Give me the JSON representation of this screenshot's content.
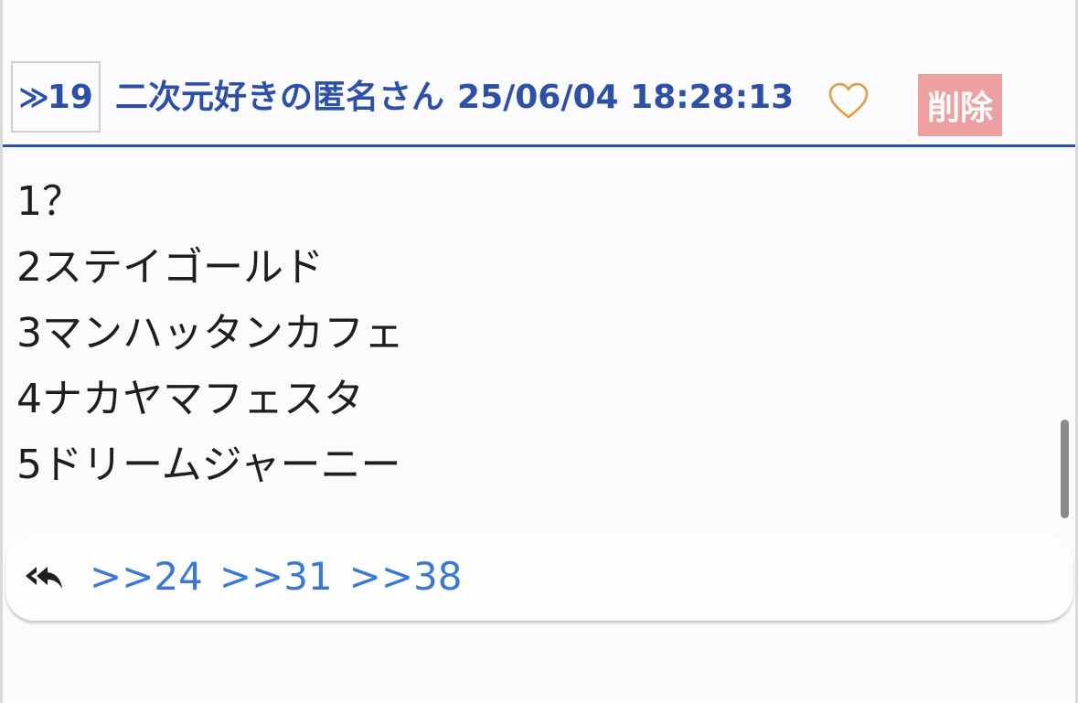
{
  "post": {
    "number_prefix": "≫",
    "number": "19",
    "poster_name": "二次元好きの匿名さん",
    "timestamp": "25/06/04 18:28:13",
    "delete_label": "削除",
    "body_lines": [
      "1？",
      "2ステイゴールド",
      "3マンハッタンカフェ",
      "4ナカヤマフェスタ",
      "5ドリームジャーニー"
    ],
    "replies": [
      ">>24",
      ">>31",
      ">>38"
    ]
  },
  "icons": {
    "like": "heart-icon",
    "replies": "reply-all-icon"
  },
  "colors": {
    "accent": "#2c4fa8",
    "delete_bg": "#ee9f9f",
    "heart": "#e69a3c",
    "reply_link": "#3a78d8"
  }
}
